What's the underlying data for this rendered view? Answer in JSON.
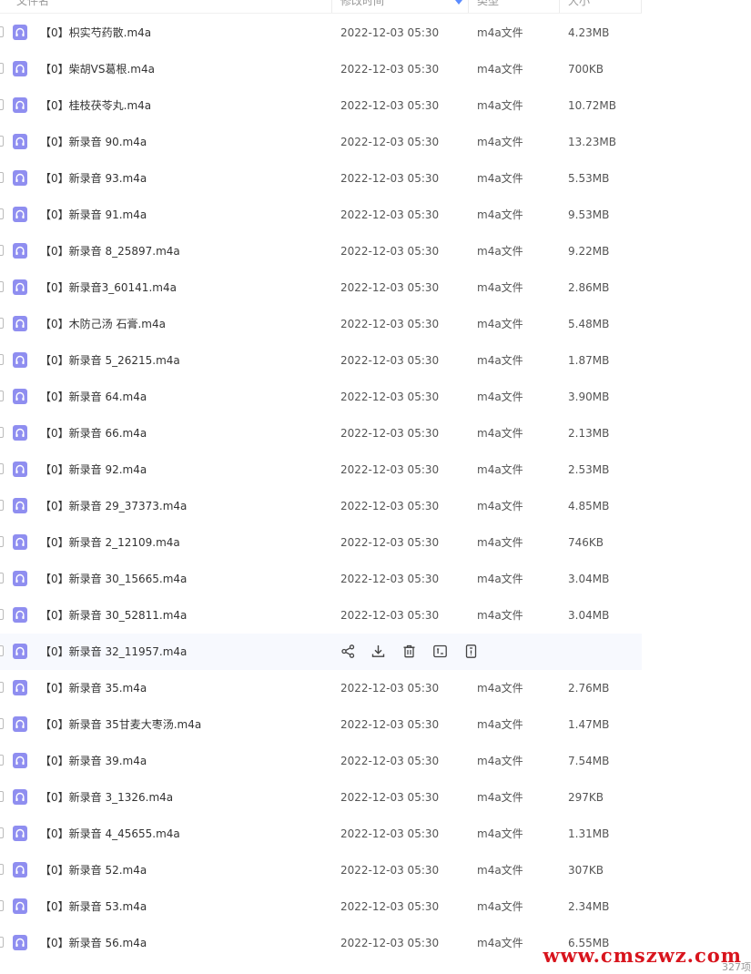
{
  "header": {
    "col_name": "文件名",
    "col_modified": "修改时间",
    "col_type": "类型",
    "col_size": "大小"
  },
  "files": [
    {
      "name": "【0】枳实芍药散.m4a",
      "date": "2022-12-03 05:30",
      "type": "m4a文件",
      "size": "4.23MB"
    },
    {
      "name": "【0】柴胡VS葛根.m4a",
      "date": "2022-12-03 05:30",
      "type": "m4a文件",
      "size": "700KB"
    },
    {
      "name": "【0】桂枝茯苓丸.m4a",
      "date": "2022-12-03 05:30",
      "type": "m4a文件",
      "size": "10.72MB"
    },
    {
      "name": "【0】新录音 90.m4a",
      "date": "2022-12-03 05:30",
      "type": "m4a文件",
      "size": "13.23MB"
    },
    {
      "name": "【0】新录音 93.m4a",
      "date": "2022-12-03 05:30",
      "type": "m4a文件",
      "size": "5.53MB"
    },
    {
      "name": "【0】新录音 91.m4a",
      "date": "2022-12-03 05:30",
      "type": "m4a文件",
      "size": "9.53MB"
    },
    {
      "name": "【0】新录音 8_25897.m4a",
      "date": "2022-12-03 05:30",
      "type": "m4a文件",
      "size": "9.22MB"
    },
    {
      "name": "【0】新录音3_60141.m4a",
      "date": "2022-12-03 05:30",
      "type": "m4a文件",
      "size": "2.86MB"
    },
    {
      "name": "【0】木防己汤 石膏.m4a",
      "date": "2022-12-03 05:30",
      "type": "m4a文件",
      "size": "5.48MB"
    },
    {
      "name": "【0】新录音 5_26215.m4a",
      "date": "2022-12-03 05:30",
      "type": "m4a文件",
      "size": "1.87MB"
    },
    {
      "name": "【0】新录音 64.m4a",
      "date": "2022-12-03 05:30",
      "type": "m4a文件",
      "size": "3.90MB"
    },
    {
      "name": "【0】新录音 66.m4a",
      "date": "2022-12-03 05:30",
      "type": "m4a文件",
      "size": "2.13MB"
    },
    {
      "name": "【0】新录音 92.m4a",
      "date": "2022-12-03 05:30",
      "type": "m4a文件",
      "size": "2.53MB"
    },
    {
      "name": "【0】新录音 29_37373.m4a",
      "date": "2022-12-03 05:30",
      "type": "m4a文件",
      "size": "4.85MB"
    },
    {
      "name": "【0】新录音 2_12109.m4a",
      "date": "2022-12-03 05:30",
      "type": "m4a文件",
      "size": "746KB"
    },
    {
      "name": "【0】新录音 30_15665.m4a",
      "date": "2022-12-03 05:30",
      "type": "m4a文件",
      "size": "3.04MB"
    },
    {
      "name": "【0】新录音 30_52811.m4a",
      "date": "2022-12-03 05:30",
      "type": "m4a文件",
      "size": "3.04MB"
    },
    {
      "name": "【0】新录音 32_11957.m4a",
      "date": "",
      "type": "",
      "size": "",
      "hovered": true
    },
    {
      "name": "【0】新录音 35.m4a",
      "date": "2022-12-03 05:30",
      "type": "m4a文件",
      "size": "2.76MB"
    },
    {
      "name": "【0】新录音 35甘麦大枣汤.m4a",
      "date": "2022-12-03 05:30",
      "type": "m4a文件",
      "size": "1.47MB"
    },
    {
      "name": "【0】新录音 39.m4a",
      "date": "2022-12-03 05:30",
      "type": "m4a文件",
      "size": "7.54MB"
    },
    {
      "name": "【0】新录音 3_1326.m4a",
      "date": "2022-12-03 05:30",
      "type": "m4a文件",
      "size": "297KB"
    },
    {
      "name": "【0】新录音 4_45655.m4a",
      "date": "2022-12-03 05:30",
      "type": "m4a文件",
      "size": "1.31MB"
    },
    {
      "name": "【0】新录音 52.m4a",
      "date": "2022-12-03 05:30",
      "type": "m4a文件",
      "size": "307KB"
    },
    {
      "name": "【0】新录音 53.m4a",
      "date": "2022-12-03 05:30",
      "type": "m4a文件",
      "size": "2.34MB"
    },
    {
      "name": "【0】新录音 56.m4a",
      "date": "2022-12-03 05:30",
      "type": "m4a文件",
      "size": "6.55MB"
    }
  ],
  "row_actions": [
    {
      "icon": "share-icon"
    },
    {
      "icon": "download-icon"
    },
    {
      "icon": "delete-icon"
    },
    {
      "icon": "rename-icon"
    },
    {
      "icon": "more-icon"
    }
  ],
  "file_icon": "audio-headphones-icon",
  "colors": {
    "icon_purple": "#8f8ef0",
    "hover_row": "#f7f9fe",
    "sort_accent": "#5b8cff",
    "watermark_red": "#d8141d"
  },
  "watermark": "www.cmszwz.com",
  "footer_count": "327项"
}
